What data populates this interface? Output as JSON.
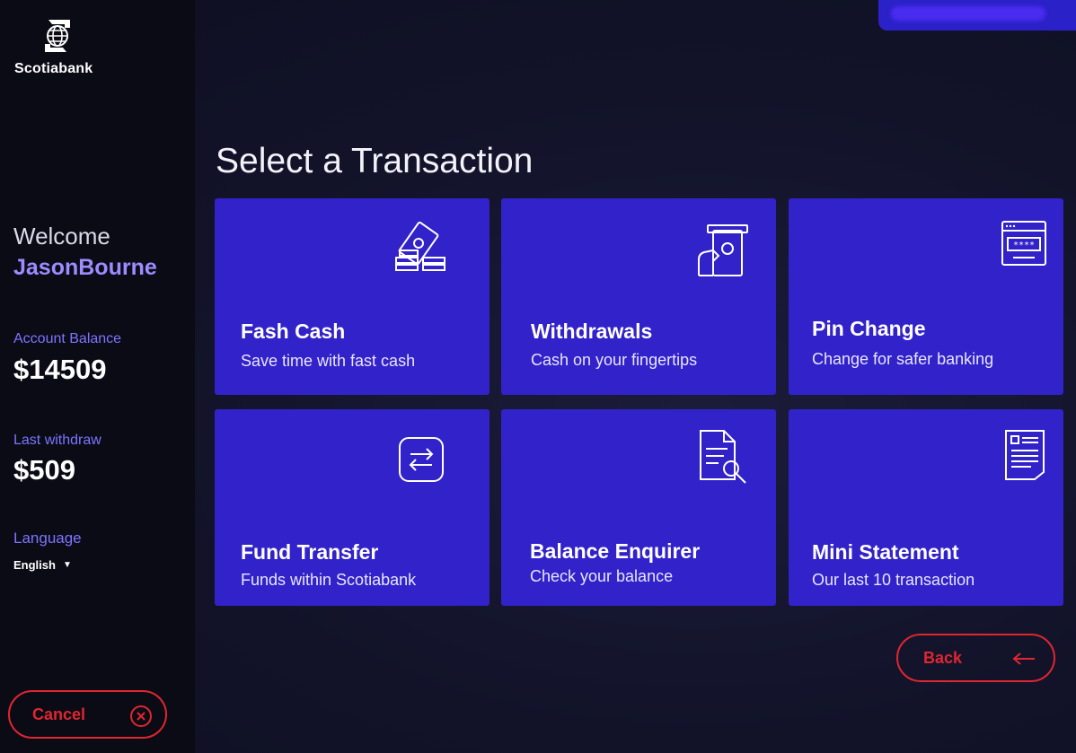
{
  "brand": {
    "name": "Scotiabank"
  },
  "user": {
    "welcome_label": "Welcome",
    "username": "JasonBourne",
    "account_balance_label": "Account Balance",
    "account_balance": "$14509",
    "last_withdraw_label": "Last withdraw",
    "last_withdraw": "$509"
  },
  "language": {
    "label": "Language",
    "selected": "English"
  },
  "buttons": {
    "cancel": "Cancel",
    "back": "Back"
  },
  "page_title": "Select a Transaction",
  "tiles": [
    {
      "title": "Fash Cash",
      "subtitle": "Save time with fast cash",
      "icon": "cash-stack-icon"
    },
    {
      "title": "Withdrawals",
      "subtitle": "Cash on your fingertips",
      "icon": "atm-withdraw-icon"
    },
    {
      "title": "Pin Change",
      "subtitle": "Change for safer banking",
      "icon": "pin-screen-icon"
    },
    {
      "title": "Fund Transfer",
      "subtitle": "Funds within Scotiabank",
      "icon": "transfer-arrows-icon"
    },
    {
      "title": "Balance Enquirer",
      "subtitle": "Check your balance",
      "icon": "document-search-icon"
    },
    {
      "title": "Mini Statement",
      "subtitle": "Our last 10 transaction",
      "icon": "statement-icon"
    }
  ],
  "colors": {
    "accent": "#3222c9",
    "danger": "#e0262f",
    "highlight": "#9b8cff",
    "label": "#7c74ff",
    "sidebar": "#0b0b16"
  }
}
